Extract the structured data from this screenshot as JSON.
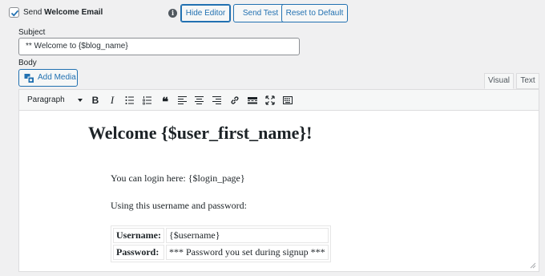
{
  "welcome_email": {
    "checkbox_label_prefix": "Send ",
    "checkbox_label_bold": "Welcome Email",
    "checked": true,
    "buttons": {
      "hide_editor": "Hide Editor",
      "send_test": "Send Test",
      "reset_default": "Reset to Default"
    }
  },
  "subject": {
    "label": "Subject",
    "value": "** Welcome to {$blog_name}"
  },
  "body": {
    "label": "Body",
    "add_media": "Add Media",
    "tabs": [
      "Visual",
      "Text"
    ],
    "active_tab": "Visual"
  },
  "toolbar": {
    "format_value": "Paragraph",
    "buttons": [
      "bold",
      "italic",
      "bulleted-list",
      "numbered-list",
      "blockquote",
      "align-left",
      "align-center",
      "align-right",
      "link",
      "read-more",
      "fullscreen",
      "toolbar-toggle"
    ]
  },
  "content": {
    "heading": "Welcome {$user_first_name}!",
    "login_line": "You can login here: {$login_page}",
    "credentials_intro": "Using this username and password:",
    "credentials": [
      {
        "key": "Username:",
        "value": "{$username}"
      },
      {
        "key": "Password:",
        "value": "*** Password you set during signup ***"
      }
    ]
  },
  "colors": {
    "accent": "#2271b1",
    "background": "#f0f0f1",
    "border": "#dcdcde"
  }
}
